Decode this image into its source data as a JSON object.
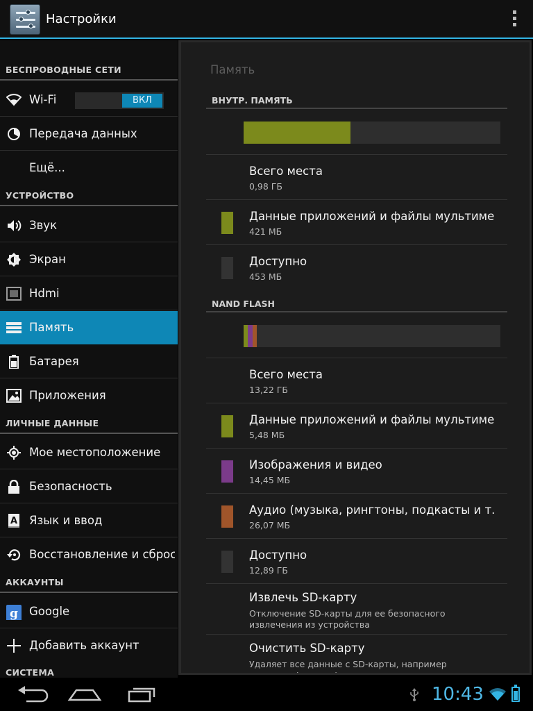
{
  "app": {
    "title": "Настройки",
    "accent": "#33b5e5"
  },
  "sidebar": {
    "sections": [
      {
        "label": "БЕСПРОВОДНЫЕ СЕТИ"
      },
      {
        "label": "УСТРОЙСТВО"
      },
      {
        "label": "ЛИЧНЫЕ ДАННЫЕ"
      },
      {
        "label": "АККАУНТЫ"
      },
      {
        "label": "СИСТЕМА"
      }
    ],
    "items": [
      {
        "label": "Wi-Fi",
        "icon": "wifi-icon"
      },
      {
        "label": "Передача данных",
        "icon": "data-usage-icon"
      },
      {
        "label": "Ещё...",
        "icon": ""
      },
      {
        "label": "Звук",
        "icon": "speaker-icon"
      },
      {
        "label": "Экран",
        "icon": "brightness-icon"
      },
      {
        "label": "Hdmi",
        "icon": "hdmi-icon"
      },
      {
        "label": "Память",
        "icon": "storage-icon",
        "selected": true
      },
      {
        "label": "Батарея",
        "icon": "battery-icon"
      },
      {
        "label": "Приложения",
        "icon": "apps-icon"
      },
      {
        "label": "Мое местоположение",
        "icon": "location-icon"
      },
      {
        "label": "Безопасность",
        "icon": "lock-icon"
      },
      {
        "label": "Язык и ввод",
        "icon": "keyboard-icon"
      },
      {
        "label": "Восстановление и сброс",
        "icon": "restore-icon"
      },
      {
        "label": "Google",
        "icon": "google-icon"
      },
      {
        "label": "Добавить аккаунт",
        "icon": "plus-icon"
      }
    ],
    "wifi_toggle": "ВКЛ",
    "selected_color": "#0e87b6"
  },
  "main": {
    "title": "Память",
    "internal": {
      "header": "ВНУТР. ПАМЯТЬ",
      "usage": [
        {
          "fraction": 0.415,
          "color": "#7c8a1c"
        }
      ],
      "rows": [
        {
          "title": "Всего места",
          "value": "0,98 ГБ",
          "color": ""
        },
        {
          "title": "Данные приложений и файлы мультимедиа",
          "value": "421 МБ",
          "color": "#7c8a1c"
        },
        {
          "title": "Доступно",
          "value": "453 МБ",
          "color": "#333333"
        }
      ]
    },
    "nand": {
      "header": "NAND FLASH",
      "usage": [
        {
          "fraction": 0.016,
          "color": "#7c8a1c"
        },
        {
          "fraction": 0.018,
          "color": "#7b3b8a"
        },
        {
          "fraction": 0.018,
          "color": "#a0552a"
        }
      ],
      "rows": [
        {
          "title": "Всего места",
          "value": "13,22 ГБ",
          "color": ""
        },
        {
          "title": "Данные приложений и файлы мультимедиа",
          "value": "5,48 МБ",
          "color": "#7c8a1c"
        },
        {
          "title": "Изображения и видео",
          "value": "14,45 МБ",
          "color": "#7b3b8a"
        },
        {
          "title": "Аудио (музыка, рингтоны, подкасты и т. п.)",
          "value": "26,07 МБ",
          "color": "#a0552a"
        },
        {
          "title": "Доступно",
          "value": "12,89 ГБ",
          "color": "#333333"
        }
      ]
    },
    "actions": [
      {
        "title": "Извлечь SD-карту",
        "description": "Отключение SD-карты для ее безопасного извлечения из устройства"
      },
      {
        "title": "Очистить SD-карту",
        "description": "Удаляет все данные с SD-карты, например музыку и фотографии"
      }
    ]
  },
  "status": {
    "time": "10:43",
    "battery_level": 0.7
  }
}
